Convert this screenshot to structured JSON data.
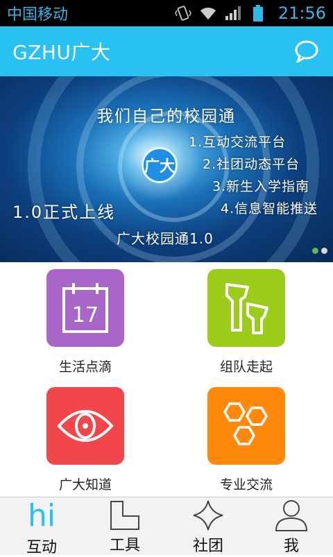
{
  "status_bar": {
    "carrier": "中国移动",
    "time": "21:56",
    "icons": [
      "vibrate-icon",
      "wifi-icon",
      "signal-icon",
      "battery-icon"
    ]
  },
  "app_bar": {
    "title": "GZHU广大",
    "action_icon": "message-bubble-icon"
  },
  "banner": {
    "headline": "我们自己的校园通",
    "features": [
      "1.互动交流平台",
      "2.社团动态平台",
      "3.新生入学指南",
      "4.信息智能推送"
    ],
    "launch": "1.0正式上线",
    "version": "广大校园通1.0",
    "logo_text": "广大",
    "pager": {
      "count": 2,
      "active": 1
    }
  },
  "grid": {
    "items": [
      {
        "label": "生活点滴",
        "icon": "calendar-icon",
        "icon_text": "17",
        "color": "#a866c6"
      },
      {
        "label": "组队走起",
        "icon": "team-icon",
        "color": "#9ccc1a"
      },
      {
        "label": "广大知道",
        "icon": "eye-icon",
        "color": "#f2474a"
      },
      {
        "label": "专业交流",
        "icon": "hexagons-icon",
        "color": "#ff8a0a"
      }
    ]
  },
  "bottom_nav": {
    "items": [
      {
        "label": "互动",
        "icon": "hi-icon",
        "icon_text": "hi",
        "active": true
      },
      {
        "label": "工具",
        "icon": "tool-icon"
      },
      {
        "label": "社团",
        "icon": "star-icon"
      },
      {
        "label": "我",
        "icon": "person-icon"
      }
    ]
  },
  "colors": {
    "accent": "#29c0f2",
    "status_text": "#33b5e5"
  }
}
